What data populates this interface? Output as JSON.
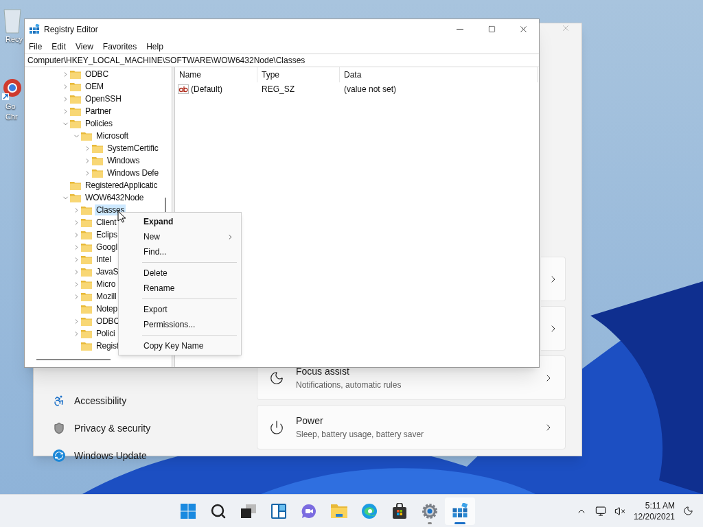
{
  "desktop": {
    "icons": [
      {
        "kind": "recycle",
        "lines": [
          "Recy"
        ]
      },
      {
        "kind": "browser",
        "lines": [
          "Go",
          "Chr"
        ]
      }
    ]
  },
  "settings": {
    "sidebar": [
      {
        "kind": "accessibility",
        "label": "Accessibility"
      },
      {
        "kind": "privacy",
        "label": "Privacy & security"
      },
      {
        "kind": "update",
        "label": "Windows Update"
      }
    ],
    "cards": [
      {
        "kind": "blank"
      },
      {
        "kind": "blank"
      },
      {
        "kind": "focus",
        "title": "Focus assist",
        "subtitle": "Notifications, automatic rules"
      },
      {
        "kind": "power",
        "title": "Power",
        "subtitle": "Sleep, battery usage, battery saver"
      }
    ]
  },
  "registry": {
    "title": "Registry Editor",
    "menu": [
      "File",
      "Edit",
      "View",
      "Favorites",
      "Help"
    ],
    "address": "Computer\\HKEY_LOCAL_MACHINE\\SOFTWARE\\WOW6432Node\\Classes",
    "tree": [
      {
        "name": "ODBC",
        "has_subkeys": true,
        "expanded": false,
        "selected": false
      },
      {
        "name": "OEM",
        "has_subkeys": true,
        "expanded": false,
        "selected": false
      },
      {
        "name": "OpenSSH",
        "has_subkeys": true,
        "expanded": false,
        "selected": false
      },
      {
        "name": "Partner",
        "has_subkeys": true,
        "expanded": false,
        "selected": false
      },
      {
        "name": "Policies",
        "has_subkeys": true,
        "expanded": true,
        "selected": false,
        "children": [
          {
            "name": "Microsoft",
            "has_subkeys": true,
            "expanded": true,
            "selected": false,
            "children": [
              {
                "name": "SystemCertific",
                "has_subkeys": true,
                "expanded": false,
                "selected": false
              },
              {
                "name": "Windows",
                "has_subkeys": true,
                "expanded": false,
                "selected": false
              },
              {
                "name": "Windows Defe",
                "has_subkeys": true,
                "expanded": false,
                "selected": false
              }
            ]
          }
        ]
      },
      {
        "name": "RegisteredApplicatic",
        "has_subkeys": false,
        "selected": false
      },
      {
        "name": "WOW6432Node",
        "has_subkeys": true,
        "expanded": true,
        "selected": false,
        "children": [
          {
            "name": "Classes",
            "has_subkeys": true,
            "expanded": false,
            "selected": true
          },
          {
            "name": "Client",
            "has_subkeys": true,
            "expanded": false,
            "selected": false
          },
          {
            "name": "Eclips",
            "has_subkeys": true,
            "expanded": false,
            "selected": false
          },
          {
            "name": "Googl",
            "has_subkeys": true,
            "expanded": false,
            "selected": false
          },
          {
            "name": "Intel",
            "has_subkeys": true,
            "expanded": false,
            "selected": false
          },
          {
            "name": "JavaS",
            "has_subkeys": true,
            "expanded": false,
            "selected": false
          },
          {
            "name": "Micro",
            "has_subkeys": true,
            "expanded": false,
            "selected": false
          },
          {
            "name": "Mozill",
            "has_subkeys": true,
            "expanded": false,
            "selected": false
          },
          {
            "name": "Notep",
            "has_subkeys": false,
            "selected": false
          },
          {
            "name": "ODBC",
            "has_subkeys": true,
            "expanded": false,
            "selected": false
          },
          {
            "name": "Polici",
            "has_subkeys": true,
            "expanded": false,
            "selected": false
          },
          {
            "name": "Regist",
            "has_subkeys": false,
            "selected": false
          }
        ]
      }
    ],
    "columns": [
      "Name",
      "Type",
      "Data"
    ],
    "rows": [
      {
        "name": "(Default)",
        "type": "REG_SZ",
        "data": "(value not set)"
      }
    ],
    "context_menu": [
      {
        "kind": "item",
        "label": "Expand",
        "default": true,
        "submenu": false
      },
      {
        "kind": "item",
        "label": "New",
        "default": false,
        "submenu": true
      },
      {
        "kind": "item",
        "label": "Find...",
        "default": false,
        "submenu": false
      },
      {
        "kind": "separator"
      },
      {
        "kind": "item",
        "label": "Delete",
        "default": false,
        "submenu": false
      },
      {
        "kind": "item",
        "label": "Rename",
        "default": false,
        "submenu": false
      },
      {
        "kind": "separator"
      },
      {
        "kind": "item",
        "label": "Export",
        "default": false,
        "submenu": false
      },
      {
        "kind": "item",
        "label": "Permissions...",
        "default": false,
        "submenu": false
      },
      {
        "kind": "separator"
      },
      {
        "kind": "item",
        "label": "Copy Key Name",
        "default": false,
        "submenu": false
      }
    ]
  },
  "taskbar": {
    "apps": [
      {
        "kind": "start",
        "active": false,
        "running": false
      },
      {
        "kind": "search",
        "active": false,
        "running": false
      },
      {
        "kind": "taskview",
        "active": false,
        "running": false
      },
      {
        "kind": "widgets",
        "active": false,
        "running": false
      },
      {
        "kind": "chat",
        "active": false,
        "running": false
      },
      {
        "kind": "explorer",
        "active": false,
        "running": false
      },
      {
        "kind": "edge",
        "active": false,
        "running": false
      },
      {
        "kind": "store",
        "active": false,
        "running": false
      },
      {
        "kind": "settings",
        "active": false,
        "running": true
      },
      {
        "kind": "regedit",
        "active": true,
        "running": true
      }
    ],
    "time": "5:11 AM",
    "date": "12/20/2021"
  }
}
